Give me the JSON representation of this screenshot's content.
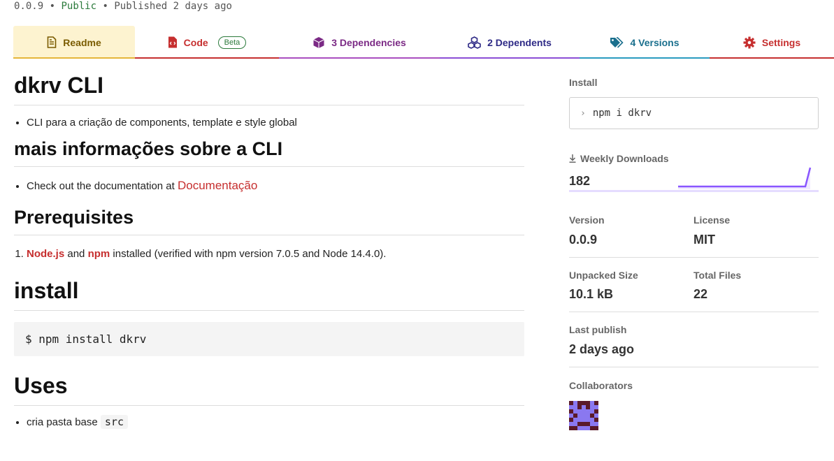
{
  "package_meta": {
    "version": "0.0.9",
    "separator": "•",
    "visibility": "Public",
    "published": "Published 2 days ago"
  },
  "tabs": [
    {
      "label": "Readme",
      "icon": "file-text-icon"
    },
    {
      "label": "Code",
      "icon": "file-code-icon",
      "badge": "Beta"
    },
    {
      "label": "3 Dependencies",
      "icon": "box-icon"
    },
    {
      "label": "2 Dependents",
      "icon": "boxes-icon"
    },
    {
      "label": "4 Versions",
      "icon": "tags-icon"
    },
    {
      "label": "Settings",
      "icon": "gear-icon"
    }
  ],
  "readme": {
    "title": "dkrv CLI",
    "intro_item": "CLI para a criação de components, template e style global",
    "more_info_heading": "mais informações sobre a CLI",
    "docs_text": "Check out the documentation at ",
    "docs_link": "Documentação",
    "prereq_heading": "Prerequisites",
    "prereq_node": "Node.js",
    "prereq_and": " and ",
    "prereq_npm": "npm",
    "prereq_rest": " installed (verified with npm version 7.0.5 and Node 14.4.0).",
    "install_heading": "install",
    "install_code": "$ npm install dkrv",
    "uses_heading": "Uses",
    "uses_item_text": "cria pasta base ",
    "uses_item_code": "src"
  },
  "sidebar": {
    "install_label": "Install",
    "install_prompt": "›",
    "install_command": "npm i dkrv",
    "weekly_downloads_label": "Weekly Downloads",
    "weekly_downloads_value": "182",
    "version_label": "Version",
    "version_value": "0.0.9",
    "license_label": "License",
    "license_value": "MIT",
    "unpacked_size_label": "Unpacked Size",
    "unpacked_size_value": "10.1 kB",
    "total_files_label": "Total Files",
    "total_files_value": "22",
    "last_publish_label": "Last publish",
    "last_publish_value": "2 days ago",
    "collaborators_label": "Collaborators"
  },
  "colors": {
    "accent_red": "#c62f2f",
    "public_green": "#2b7a3b",
    "sparkline": "#8956ff"
  }
}
